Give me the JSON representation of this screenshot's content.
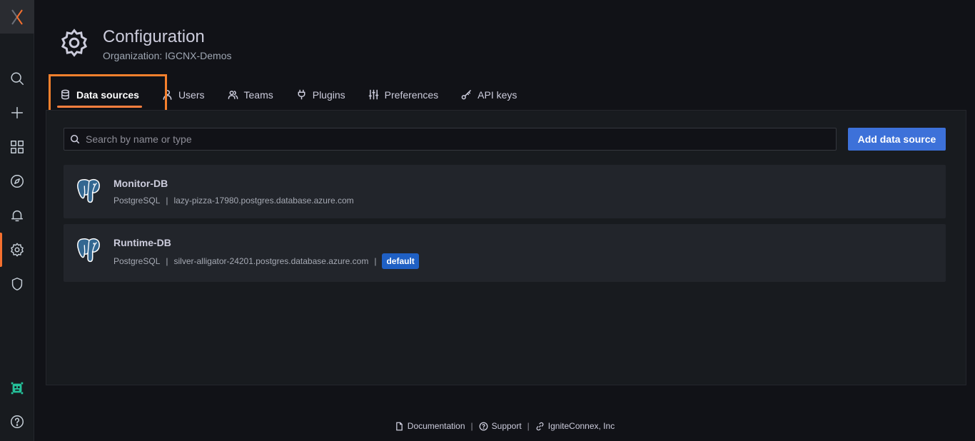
{
  "header": {
    "title": "Configuration",
    "subtitle": "Organization: IGCNX-Demos"
  },
  "tabs": [
    {
      "label": "Data sources",
      "icon": "database-icon",
      "active": true
    },
    {
      "label": "Users",
      "icon": "user-icon"
    },
    {
      "label": "Teams",
      "icon": "users-icon"
    },
    {
      "label": "Plugins",
      "icon": "plug-icon"
    },
    {
      "label": "Preferences",
      "icon": "sliders-icon"
    },
    {
      "label": "API keys",
      "icon": "key-icon"
    }
  ],
  "search": {
    "placeholder": "Search by name or type",
    "value": ""
  },
  "add_button": "Add data source",
  "datasources": [
    {
      "name": "Monitor-DB",
      "type": "PostgreSQL",
      "separator": "|",
      "url": "lazy-pizza-17980.postgres.database.azure.com"
    },
    {
      "name": "Runtime-DB",
      "type": "PostgreSQL",
      "separator": "|",
      "url": "silver-alligator-24201.postgres.database.azure.com",
      "separator2": "|",
      "badge": "default"
    }
  ],
  "footer": {
    "documentation": "Documentation",
    "support": "Support",
    "company": "IgniteConnex, Inc",
    "separator": "|"
  },
  "colors": {
    "accent": "#f5702f",
    "primary": "#3d71d9",
    "badge": "#1f60c4"
  }
}
